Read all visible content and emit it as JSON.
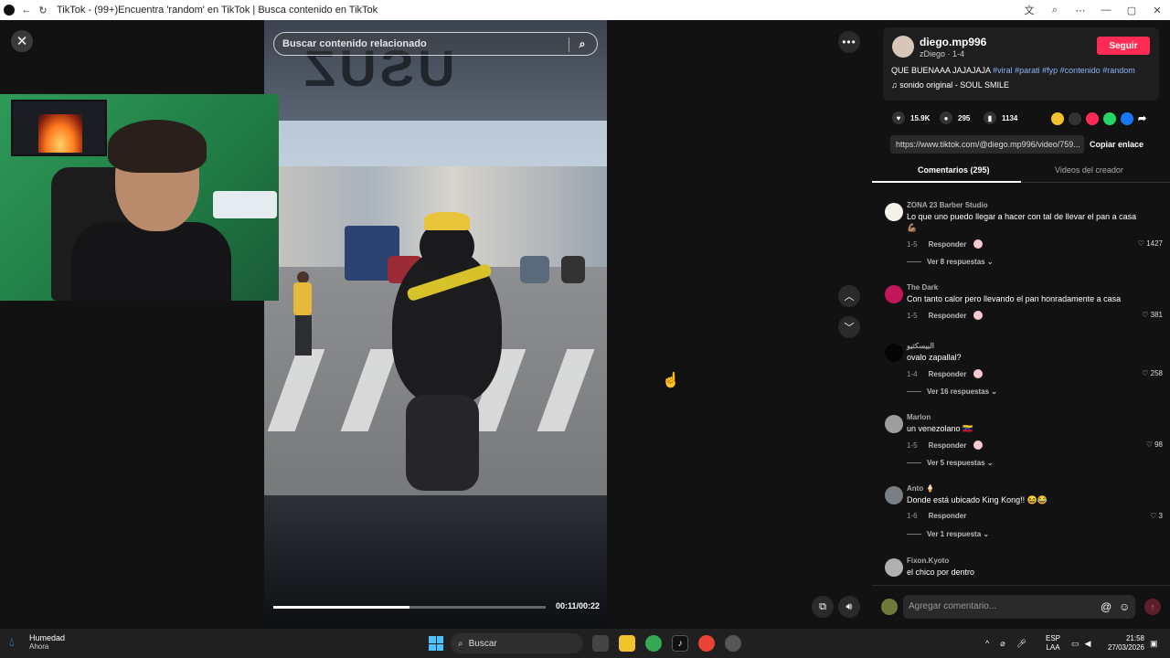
{
  "window": {
    "title": "TikTok - (99+)Encuentra 'random' en TikTok | Busca contenido en TikTok",
    "controls": [
      "—",
      "▢",
      "✕"
    ]
  },
  "player": {
    "search_placeholder": "Buscar contenido relacionado",
    "time": "00:11/00:22",
    "progress": 0.5,
    "roof_text": "USUZ"
  },
  "author": {
    "username": "diego.mp996",
    "subline": "zDiego · 1-4",
    "follow_label": "Seguir",
    "caption_text": "QUE BUENAAA JAJAJAJA",
    "hashtags": [
      "#viral",
      "#parati",
      "#fyp",
      "#contenido",
      "#random"
    ],
    "sound": "sonido original - SOUL SMILE"
  },
  "stats": {
    "likes": "15.9K",
    "comments": "295",
    "saves": "1134"
  },
  "link": {
    "url": "https://www.tiktok.com/@diego.mp996/video/759...",
    "copy_label": "Copiar enlace"
  },
  "tabs": {
    "comments": "Comentarios (295)",
    "creator": "Videos del creador"
  },
  "comments": [
    {
      "user": "ZONA 23 Barber Studio",
      "text": "Lo que uno puedo llegar a hacer con tal de llevar el pan a casa 💪🏽",
      "date": "1-5",
      "likes": "1427",
      "replies": "Ver 8 respuestas",
      "creator_liked": true
    },
    {
      "user": "The Dark",
      "text": "Con tanto calor pero llevando el pan honradamente a casa",
      "date": "1-5",
      "likes": "381",
      "replies": "",
      "creator_liked": true
    },
    {
      "user": "البيسكتيو",
      "text": "ovalo zapallal?",
      "date": "1-4",
      "likes": "258",
      "replies": "Ver 16 respuestas",
      "creator_liked": true
    },
    {
      "user": "Marlon",
      "text": "un venezolano 🇻🇪",
      "date": "1-5",
      "likes": "98",
      "replies": "Ver 5 respuestas",
      "creator_liked": true
    },
    {
      "user": "Anto 🍦",
      "text": "Donde está ubicado King Kong!! 😆😂",
      "date": "1-6",
      "likes": "3",
      "replies": "Ver 1 respuesta",
      "creator_liked": false
    },
    {
      "user": "Fixon.Kyoto",
      "text": "el chico por dentro",
      "date": "",
      "likes": "",
      "replies": "",
      "creator_liked": false
    }
  ],
  "reply_label": "Responder",
  "comment_input_placeholder": "Agregar comentario...",
  "taskbar": {
    "weather_title": "Humedad",
    "weather_sub": "Ahora",
    "search_label": "Buscar",
    "lang_top": "ESP",
    "lang_bottom": "LAA",
    "time": "21:58",
    "date": "27/03/2026"
  },
  "colors": {
    "accent": "#fe2c55",
    "hashtag": "#8ab4f8",
    "panel_bg": "#121212"
  }
}
